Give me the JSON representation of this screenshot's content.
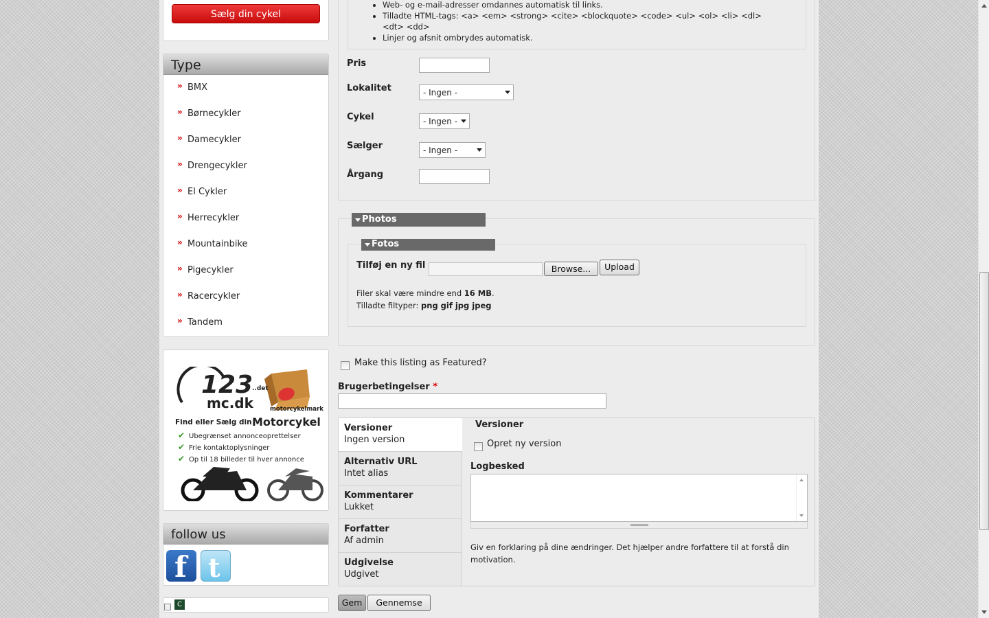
{
  "sidebar": {
    "sell_button": "Sælg din cykel",
    "type_heading": "Type",
    "types": [
      "BMX",
      "Børnecykler",
      "Damecykler",
      "Drengecykler",
      "El Cykler",
      "Herrecykler",
      "Mountainbike",
      "Pigecykler",
      "Racercykler",
      "Tandem"
    ],
    "ad": {
      "logo_text": "123",
      "logo_sub": "mc.dk",
      "box_text": "..det",
      "market_text": "motorcykelmarked",
      "headline_small": "Find eller Sælg din",
      "headline_big": "Motorcykel",
      "bullets": [
        "Ubegrænset annonceoprettelser",
        "Frie kontaktoplysninger",
        "Op til 18 billeder til hver annonce"
      ]
    },
    "follow_heading": "follow us"
  },
  "tips": [
    "Web- og e-mail-adresser omdannes automatisk til links.",
    "Tilladte HTML-tags: <a> <em> <strong> <cite> <blockquote> <code> <ul> <ol> <li> <dl> <dt> <dd>",
    "Linjer og afsnit ombrydes automatisk."
  ],
  "form": {
    "pris_label": "Pris",
    "lokalitet_label": "Lokalitet",
    "lokalitet_value": "- Ingen -",
    "cykel_label": "Cykel",
    "cykel_value": "- Ingen -",
    "saelger_label": "Sælger",
    "saelger_value": "- Ingen -",
    "aargang_label": "Årgang"
  },
  "photos": {
    "legend": "Photos",
    "inner_legend": "Fotos",
    "add_file_label": "Tilføj en ny fil",
    "browse_label": "Browse...",
    "upload_label": "Upload",
    "size_note_prefix": "Filer skal være mindre end",
    "size_note_value": "16 MB",
    "size_note_suffix": ".",
    "types_prefix": "Tilladte filtyper:",
    "types_value": "png gif jpg jpeg"
  },
  "featured_label": "Make this listing as Featured?",
  "terms_label": "Brugerbetingelser",
  "terms_required": "*",
  "vtabs": [
    {
      "title": "Versioner",
      "summary": "Ingen version"
    },
    {
      "title": "Alternativ URL",
      "summary": "Intet alias"
    },
    {
      "title": "Kommentarer",
      "summary": "Lukket"
    },
    {
      "title": "Forfatter",
      "summary": "Af admin"
    },
    {
      "title": "Udgivelse",
      "summary": "Udgivet"
    }
  ],
  "panel": {
    "heading": "Versioner",
    "new_version_label": "Opret ny version",
    "log_label": "Logbesked",
    "help": "Giv en forklaring på dine ændringer. Det hjælper andre forfattere til at forstå din motivation."
  },
  "actions": {
    "save": "Gem",
    "preview": "Gennemse"
  },
  "colors": {
    "accent_red": "#c80c0c",
    "legend_gray": "#696969",
    "facebook": "#1c4f9c",
    "twitter": "#6cc4ea"
  }
}
